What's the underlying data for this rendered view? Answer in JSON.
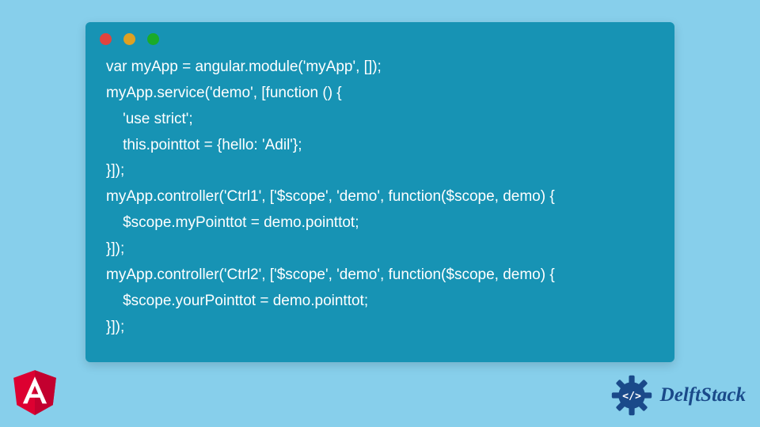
{
  "code": {
    "lines": [
      "var myApp = angular.module('myApp', []);",
      "myApp.service('demo', [function () {",
      "    'use strict';",
      "    this.pointtot = {hello: 'Adil'};",
      "}]);",
      "myApp.controller('Ctrl1', ['$scope', 'demo', function($scope, demo) {",
      "    $scope.myPointtot = demo.pointtot;",
      "}]);",
      "myApp.controller('Ctrl2', ['$scope', 'demo', function($scope, demo) {",
      "    $scope.yourPointtot = demo.pointtot;",
      "}]);"
    ]
  },
  "branding": {
    "angular_letter": "A",
    "delftstack_label": "DelftStack"
  },
  "colors": {
    "page_bg": "#87cfeb",
    "window_bg": "#1793b4",
    "traffic_red": "#e0443e",
    "traffic_yellow": "#dea123",
    "traffic_green": "#1aab29",
    "angular_red": "#dd0031",
    "delftstack_blue": "#1a4a8a"
  }
}
